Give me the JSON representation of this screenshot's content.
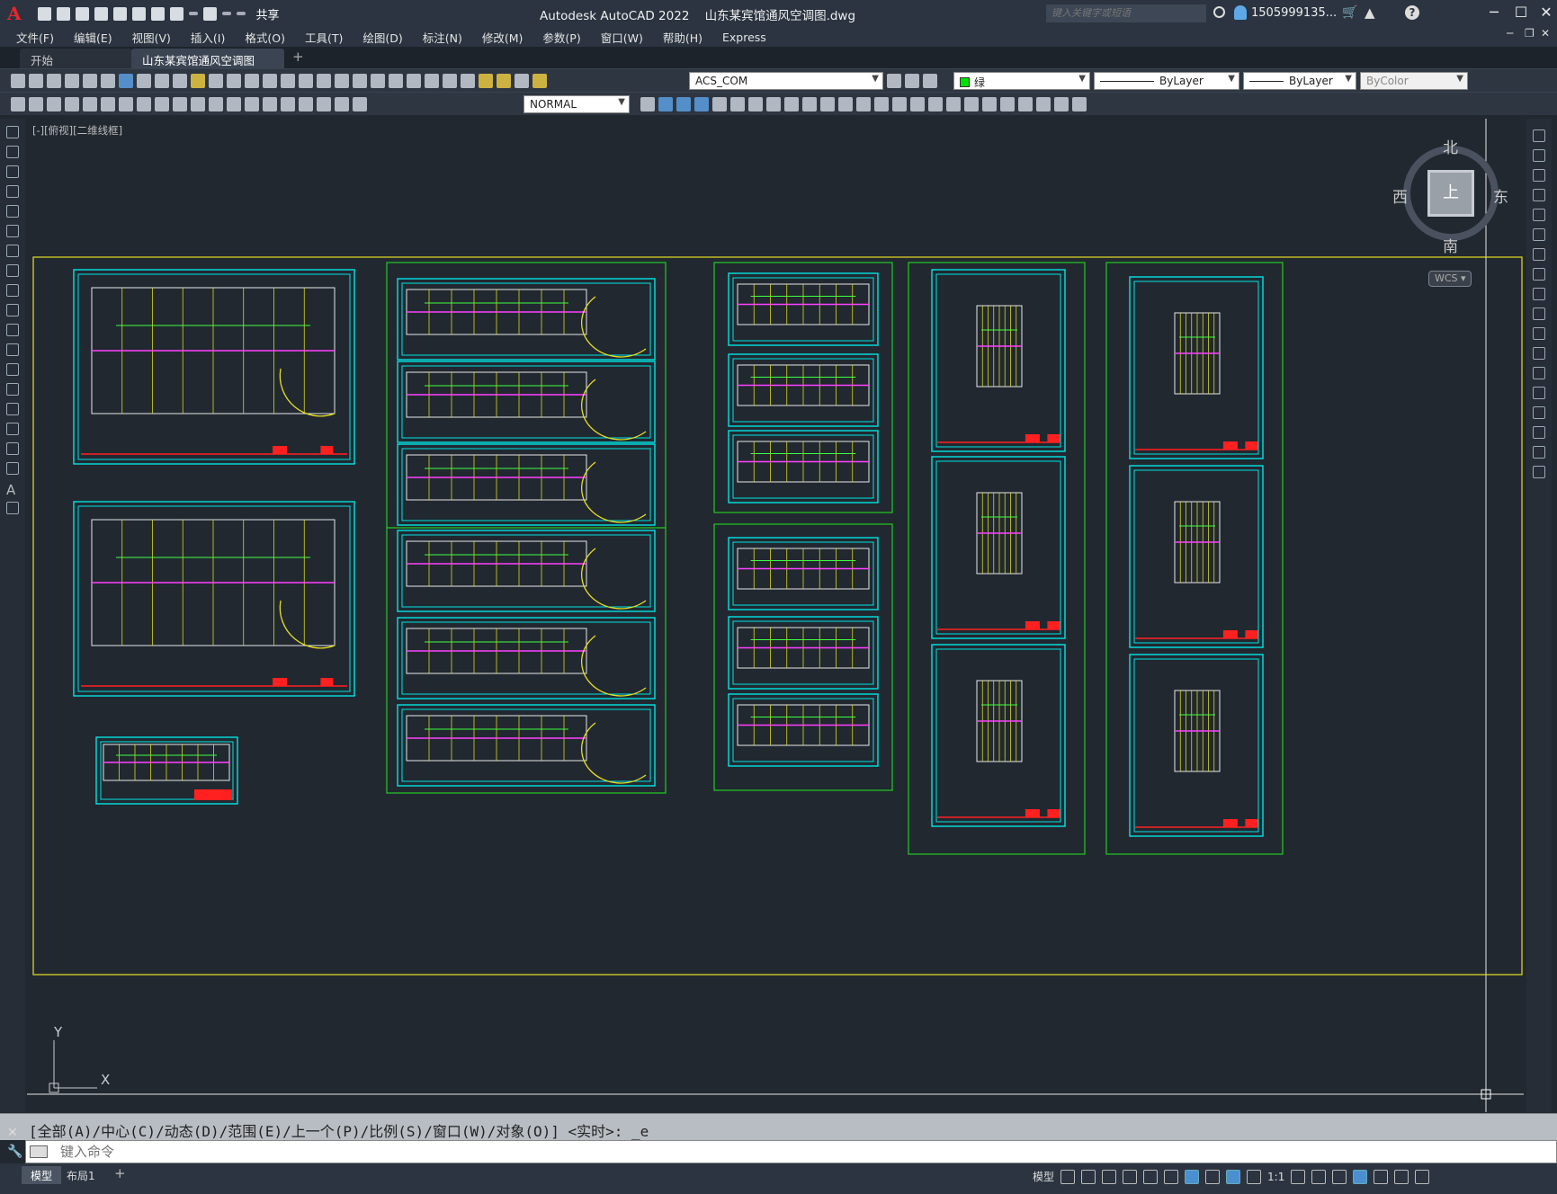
{
  "app": {
    "title": "Autodesk AutoCAD 2022    山东某宾馆通风空调图.dwg",
    "share_label": "共享",
    "search_placeholder": "键入关键字或短语",
    "username": "1505999135...",
    "logo_letter": "A"
  },
  "menubar": {
    "items": [
      "文件(F)",
      "编辑(E)",
      "视图(V)",
      "插入(I)",
      "格式(O)",
      "工具(T)",
      "绘图(D)",
      "标注(N)",
      "修改(M)",
      "参数(P)",
      "窗口(W)",
      "帮助(H)",
      "Express"
    ]
  },
  "tabs": [
    {
      "label": "开始",
      "active": false
    },
    {
      "label": "山东某宾馆通风空调图*",
      "active": true
    }
  ],
  "toolbar": {
    "ucs_name": "ACS_COM",
    "color_name": "绿",
    "color_hex": "#00e000",
    "linetype": "ByLayer",
    "lineweight": "ByLayer",
    "plotstyle": "ByColor",
    "dimstyle": "NORMAL"
  },
  "viewport": {
    "label": "[-][俯视][二维线框]"
  },
  "viewcube": {
    "north": "北",
    "south": "南",
    "east": "东",
    "west": "西",
    "face": "上",
    "wcs": "WCS"
  },
  "ucs_icon": {
    "x_label": "X",
    "y_label": "Y"
  },
  "command": {
    "history": "[全部(A)/中心(C)/动态(D)/范围(E)/上一个(P)/比例(S)/窗口(W)/对象(O)] <实时>: _e",
    "placeholder": "键入命令"
  },
  "statusbar": {
    "layout_tabs": [
      {
        "label": "模型",
        "active": true
      },
      {
        "label": "布局1",
        "active": false
      }
    ],
    "model_label": "模型",
    "scale_label": "1:1"
  },
  "colors": {
    "frame_cyan": "#00e5e5",
    "group_green": "#22cc22",
    "boundary_yellow": "#e8e020",
    "titleblock_red": "#ff2020"
  }
}
